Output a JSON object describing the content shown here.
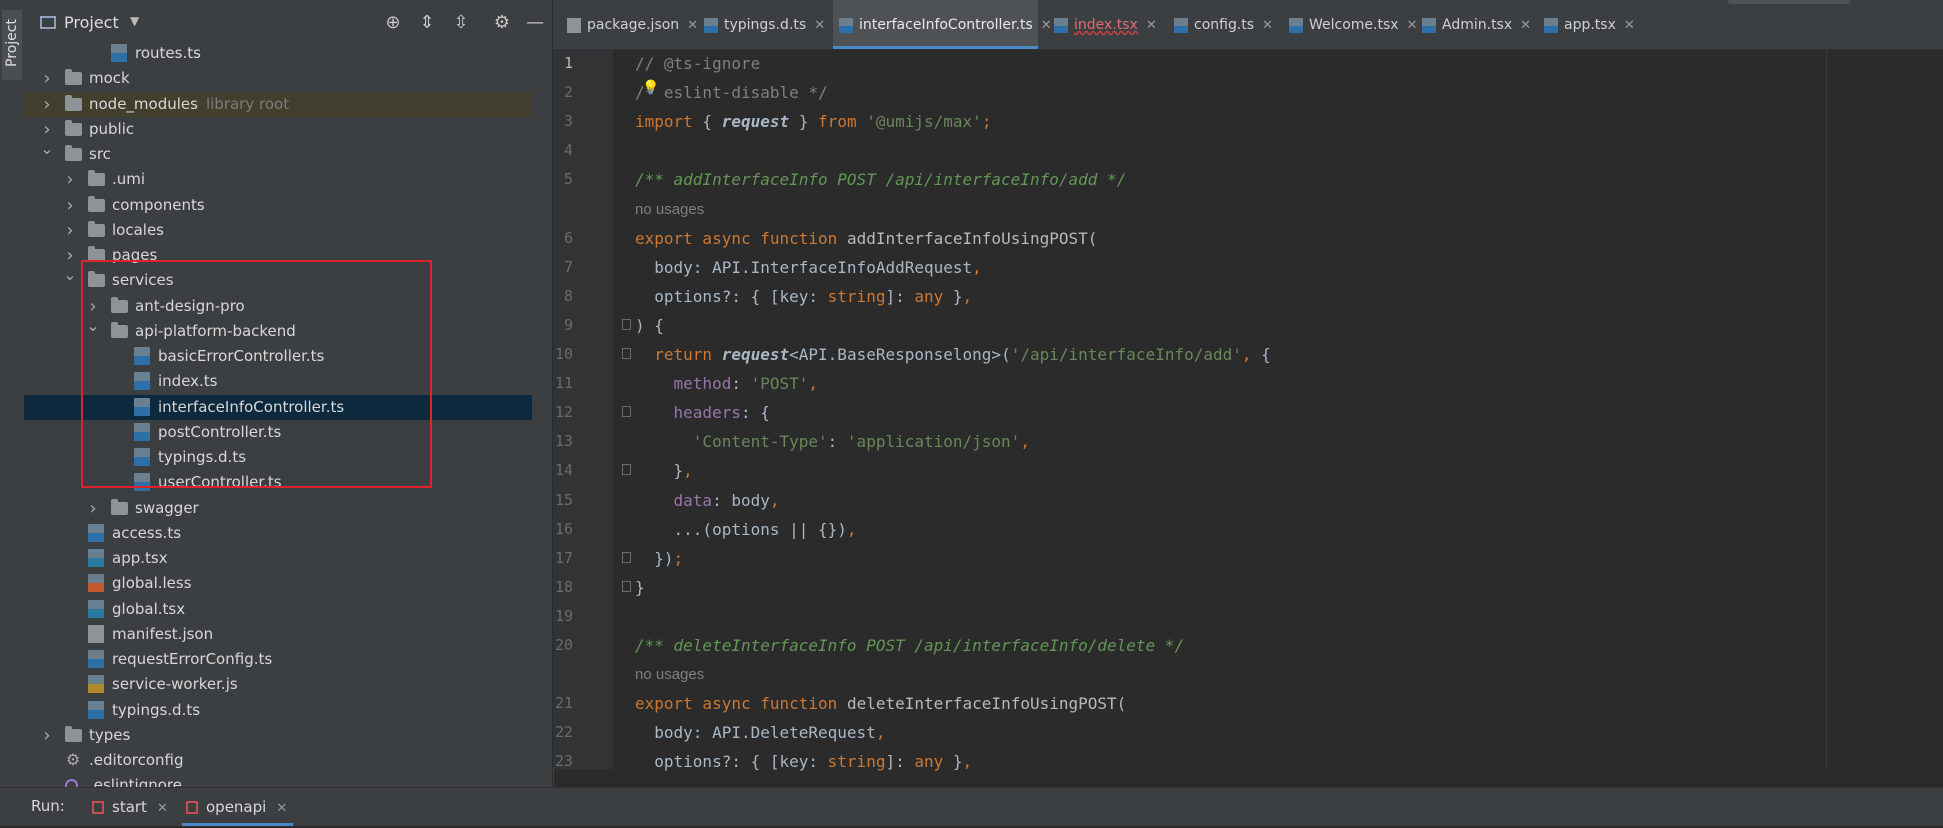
{
  "sidebar_stripe": {
    "label": "Project"
  },
  "project": {
    "title": "Project",
    "tree": [
      {
        "label": "routes.ts",
        "icon": "ts-file-icon",
        "indent": 3,
        "arrow": ""
      },
      {
        "label": "mock",
        "icon": "folder-icon",
        "indent": 1,
        "arrow": "right"
      },
      {
        "label": "node_modules",
        "extra": "library root",
        "icon": "folder-icon",
        "indent": 1,
        "arrow": "right",
        "excluded": true
      },
      {
        "label": "public",
        "icon": "folder-icon",
        "indent": 1,
        "arrow": "right"
      },
      {
        "label": "src",
        "icon": "folder-icon",
        "indent": 1,
        "arrow": "down"
      },
      {
        "label": ".umi",
        "icon": "folder-icon",
        "indent": 2,
        "arrow": "right"
      },
      {
        "label": "components",
        "icon": "folder-icon",
        "indent": 2,
        "arrow": "right"
      },
      {
        "label": "locales",
        "icon": "folder-icon",
        "indent": 2,
        "arrow": "right"
      },
      {
        "label": "pages",
        "icon": "folder-icon",
        "indent": 2,
        "arrow": "right"
      },
      {
        "label": "services",
        "icon": "folder-icon",
        "indent": 2,
        "arrow": "down"
      },
      {
        "label": "ant-design-pro",
        "icon": "folder-icon",
        "indent": 3,
        "arrow": "right"
      },
      {
        "label": "api-platform-backend",
        "icon": "folder-icon",
        "indent": 3,
        "arrow": "down"
      },
      {
        "label": "basicErrorController.ts",
        "icon": "ts-file-icon",
        "indent": 4,
        "arrow": ""
      },
      {
        "label": "index.ts",
        "icon": "ts-file-icon",
        "indent": 4,
        "arrow": ""
      },
      {
        "label": "interfaceInfoController.ts",
        "icon": "ts-file-icon",
        "indent": 4,
        "arrow": "",
        "selected": true
      },
      {
        "label": "postController.ts",
        "icon": "ts-file-icon",
        "indent": 4,
        "arrow": ""
      },
      {
        "label": "typings.d.ts",
        "icon": "ts-file-icon",
        "indent": 4,
        "arrow": ""
      },
      {
        "label": "userController.ts",
        "icon": "ts-file-icon",
        "indent": 4,
        "arrow": ""
      },
      {
        "label": "swagger",
        "icon": "folder-icon",
        "indent": 3,
        "arrow": "right"
      },
      {
        "label": "access.ts",
        "icon": "ts-file-icon",
        "indent": 2,
        "arrow": ""
      },
      {
        "label": "app.tsx",
        "icon": "tsx-file-icon",
        "indent": 2,
        "arrow": ""
      },
      {
        "label": "global.less",
        "icon": "less-file-icon",
        "indent": 2,
        "arrow": ""
      },
      {
        "label": "global.tsx",
        "icon": "tsx-file-icon",
        "indent": 2,
        "arrow": ""
      },
      {
        "label": "manifest.json",
        "icon": "json-file-icon",
        "indent": 2,
        "arrow": ""
      },
      {
        "label": "requestErrorConfig.ts",
        "icon": "ts-file-icon",
        "indent": 2,
        "arrow": ""
      },
      {
        "label": "service-worker.js",
        "icon": "js-file-icon",
        "indent": 2,
        "arrow": ""
      },
      {
        "label": "typings.d.ts",
        "icon": "ts-file-icon",
        "indent": 2,
        "arrow": ""
      },
      {
        "label": "types",
        "icon": "folder-icon",
        "indent": 1,
        "arrow": "right"
      },
      {
        "label": ".editorconfig",
        "icon": "gear-file-icon",
        "indent": 1,
        "arrow": ""
      },
      {
        "label": ".eslintignore",
        "icon": "eslint-file-icon",
        "indent": 1,
        "arrow": ""
      }
    ]
  },
  "tabs": [
    {
      "label": "package.json",
      "icon": "json-file-icon"
    },
    {
      "label": "typings.d.ts",
      "icon": "ts-file-icon"
    },
    {
      "label": "interfaceInfoController.ts",
      "icon": "ts-file-icon",
      "active": true
    },
    {
      "label": "index.tsx",
      "icon": "tsx-file-icon",
      "error": true
    },
    {
      "label": "config.ts",
      "icon": "ts-file-icon"
    },
    {
      "label": "Welcome.tsx",
      "icon": "tsx-file-icon"
    },
    {
      "label": "Admin.tsx",
      "icon": "tsx-file-icon"
    },
    {
      "label": "app.tsx",
      "icon": "tsx-file-icon"
    }
  ],
  "code_lines": [
    {
      "n": "1",
      "tokens": [
        [
          "c-com",
          "// @ts-ignore"
        ]
      ]
    },
    {
      "n": "2",
      "bulb": true,
      "tokens": [
        [
          "c-com",
          "/* eslint-disable */"
        ]
      ]
    },
    {
      "n": "3",
      "tokens": [
        [
          "c-kw",
          "import"
        ],
        [
          "c-plain",
          " { "
        ],
        [
          "c-call",
          "request"
        ],
        [
          "c-plain",
          " } "
        ],
        [
          "c-kw",
          "from"
        ],
        [
          "c-plain",
          " "
        ],
        [
          "c-str",
          "'@umijs/max'"
        ],
        [
          "c-kw",
          ";"
        ]
      ]
    },
    {
      "n": "4",
      "tokens": []
    },
    {
      "n": "5",
      "tokens": [
        [
          "c-doc",
          "/** addInterfaceInfo POST /api/interfaceInfo/add */"
        ]
      ]
    },
    {
      "n": "",
      "hint": "no usages"
    },
    {
      "n": "6",
      "tokens": [
        [
          "c-kw",
          "export async function"
        ],
        [
          "c-plain",
          " "
        ],
        [
          "c-fn",
          "addInterfaceInfoUsingPOST"
        ],
        [
          "c-plain",
          "("
        ]
      ]
    },
    {
      "n": "7",
      "tokens": [
        [
          "c-plain",
          "  body: API.InterfaceInfoAddRequest"
        ],
        [
          "c-kw",
          ","
        ]
      ]
    },
    {
      "n": "8",
      "tokens": [
        [
          "c-plain",
          "  options?: { [key: "
        ],
        [
          "c-type",
          "string"
        ],
        [
          "c-plain",
          "]: "
        ],
        [
          "c-type",
          "any"
        ],
        [
          "c-plain",
          " }"
        ],
        [
          "c-kw",
          ","
        ]
      ]
    },
    {
      "n": "9",
      "fold": true,
      "tokens": [
        [
          "c-plain",
          ") {"
        ]
      ]
    },
    {
      "n": "10",
      "fold": true,
      "tokens": [
        [
          "c-plain",
          "  "
        ],
        [
          "c-kw",
          "return"
        ],
        [
          "c-plain",
          " "
        ],
        [
          "c-call",
          "request"
        ],
        [
          "c-plain",
          "<API.BaseResponselong>("
        ],
        [
          "c-str",
          "'/api/interfaceInfo/add'"
        ],
        [
          "c-kw",
          ","
        ],
        [
          "c-plain",
          " {"
        ]
      ]
    },
    {
      "n": "11",
      "tokens": [
        [
          "c-plain",
          "    "
        ],
        [
          "c-prop",
          "method"
        ],
        [
          "c-plain",
          ": "
        ],
        [
          "c-str",
          "'POST'"
        ],
        [
          "c-kw",
          ","
        ]
      ]
    },
    {
      "n": "12",
      "fold": true,
      "tokens": [
        [
          "c-plain",
          "    "
        ],
        [
          "c-prop",
          "headers"
        ],
        [
          "c-plain",
          ": {"
        ]
      ]
    },
    {
      "n": "13",
      "tokens": [
        [
          "c-plain",
          "      "
        ],
        [
          "c-str",
          "'Content-Type'"
        ],
        [
          "c-plain",
          ": "
        ],
        [
          "c-str",
          "'application/json'"
        ],
        [
          "c-kw",
          ","
        ]
      ]
    },
    {
      "n": "14",
      "fold": true,
      "tokens": [
        [
          "c-plain",
          "    }"
        ],
        [
          "c-kw",
          ","
        ]
      ]
    },
    {
      "n": "15",
      "tokens": [
        [
          "c-plain",
          "    "
        ],
        [
          "c-prop",
          "data"
        ],
        [
          "c-plain",
          ": body"
        ],
        [
          "c-kw",
          ","
        ]
      ]
    },
    {
      "n": "16",
      "tokens": [
        [
          "c-plain",
          "    ...(options || {})"
        ],
        [
          "c-kw",
          ","
        ]
      ]
    },
    {
      "n": "17",
      "fold": true,
      "tokens": [
        [
          "c-plain",
          "  })"
        ],
        [
          "c-kw",
          ";"
        ]
      ]
    },
    {
      "n": "18",
      "fold": true,
      "tokens": [
        [
          "c-plain",
          "}"
        ]
      ]
    },
    {
      "n": "19",
      "tokens": []
    },
    {
      "n": "20",
      "tokens": [
        [
          "c-doc",
          "/** deleteInterfaceInfo POST /api/interfaceInfo/delete */"
        ]
      ]
    },
    {
      "n": "",
      "hint": "no usages"
    },
    {
      "n": "21",
      "tokens": [
        [
          "c-kw",
          "export async function"
        ],
        [
          "c-plain",
          " "
        ],
        [
          "c-fn",
          "deleteInterfaceInfoUsingPOST"
        ],
        [
          "c-plain",
          "("
        ]
      ]
    },
    {
      "n": "22",
      "tokens": [
        [
          "c-plain",
          "  body: API.DeleteRequest"
        ],
        [
          "c-kw",
          ","
        ]
      ]
    },
    {
      "n": "23",
      "tokens": [
        [
          "c-plain",
          "  options?: { [key: "
        ],
        [
          "c-type",
          "string"
        ],
        [
          "c-plain",
          "]: "
        ],
        [
          "c-type",
          "any"
        ],
        [
          "c-plain",
          " }"
        ],
        [
          "c-kw",
          ","
        ]
      ]
    }
  ],
  "run": {
    "label": "Run:",
    "tabs": [
      {
        "label": "start",
        "active": false
      },
      {
        "label": "openapi",
        "active": true
      }
    ]
  },
  "colors": {
    "accent": "#4a88c7",
    "highlight_box": "#e0222c",
    "selection": "#0d293e"
  }
}
